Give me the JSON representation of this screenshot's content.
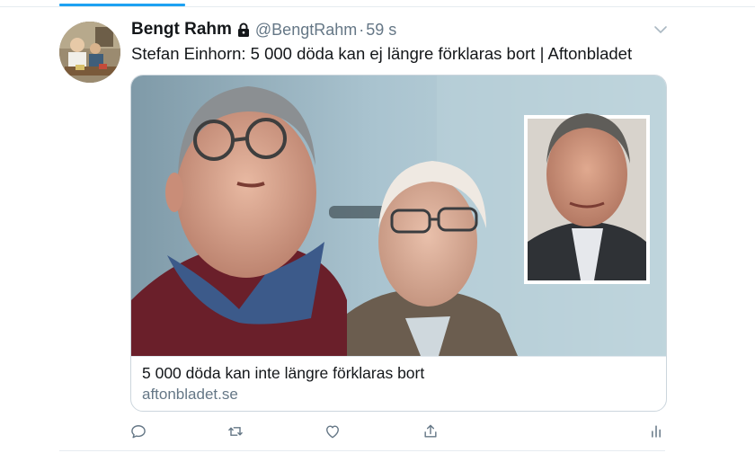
{
  "tweet": {
    "display_name": "Bengt Rahm",
    "handle": "@BengtRahm",
    "separator": "·",
    "time": "59 s",
    "protected_icon": "lock-icon",
    "more_icon": "chevron-down-icon",
    "text": "Stefan Einhorn: 5 000 döda kan ej längre förklaras bort | Aftonbladet"
  },
  "card": {
    "title": "5 000 döda kan inte längre förklaras bort",
    "domain": "aftonbladet.se"
  },
  "actions": [
    {
      "icon": "reply-icon"
    },
    {
      "icon": "retweet-icon"
    },
    {
      "icon": "like-icon"
    },
    {
      "icon": "share-icon"
    },
    {
      "icon": "analytics-icon"
    }
  ],
  "colors": {
    "accent": "#1da1f2",
    "text_primary": "#14171a",
    "text_secondary": "#657786",
    "border": "#ccd6dd"
  }
}
